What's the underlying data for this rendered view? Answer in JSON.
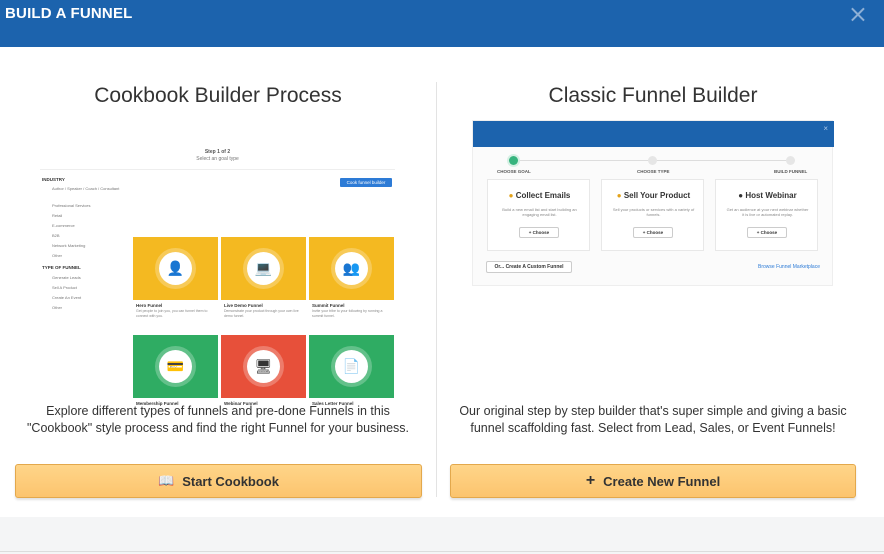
{
  "header": {
    "title": "BUILD A FUNNEL",
    "close_label": "×"
  },
  "cookbook": {
    "title": "Cookbook Builder Process",
    "description_line1": "Explore different types of funnels and pre-done Funnels in this",
    "description_line2": "\"Cookbook\" style process and find the right Funnel for your business.",
    "button_label": "Start Cookbook",
    "button_icon": "book-icon",
    "preview": {
      "step_label": "Step 1 of 2",
      "step_sub": "Select an goal type",
      "start_label": "Cook funnel builder",
      "industry_heading": "INDUSTRY",
      "industry_items": [
        "Author / Speaker / Coach / Consultant",
        "Professional Services",
        "Retail",
        "E-commerce",
        "B2B",
        "Network Marketing",
        "Other"
      ],
      "type_heading": "TYPE OF FUNNEL",
      "type_items": [
        "Generate Leads",
        "Sell A Product",
        "Create An Event",
        "Other"
      ],
      "tiles": [
        {
          "caption": "Hero Funnel",
          "sub": "Get people to join you, you can funnel them to connect with you.",
          "color": "#f4b921",
          "icon": "👤"
        },
        {
          "caption": "Live Demo Funnel",
          "sub": "Demonstrate your product through your own live demo funnel.",
          "color": "#f4b921",
          "icon": "💻"
        },
        {
          "caption": "Summit Funnel",
          "sub": "Invite your tribe to your following by running a summit funnel.",
          "color": "#f4b921",
          "icon": "👥"
        },
        {
          "caption": "Membership Funnel",
          "sub": "",
          "color": "#2fac63",
          "icon": "💳"
        },
        {
          "caption": "Webinar Funnel",
          "sub": "",
          "color": "#e7503a",
          "icon": "🖥"
        },
        {
          "caption": "Sales Letter Funnel",
          "sub": "",
          "color": "#2fac63",
          "icon": "📄"
        }
      ]
    }
  },
  "classic": {
    "title": "Classic Funnel Builder",
    "description_line1": "Our original step by step builder that's super simple and giving a basic",
    "description_line2": "funnel scaffolding fast. Select from Lead, Sales, or Event Funnels!",
    "button_label": "Create New Funnel",
    "button_icon": "plus-icon",
    "preview": {
      "close_label": "×",
      "steps": [
        "CHOOSE GOAL",
        "CHOOSE TYPE",
        "BUILD FUNNEL"
      ],
      "cards": [
        {
          "title": "Collect Emails",
          "desc": "Build a new email list and start building an engaging email list.",
          "btn": "+ Choose",
          "icon": "envelope-icon"
        },
        {
          "title": "Sell Your Product",
          "desc": "Sell your products or services with a variety of funnels.",
          "btn": "+ Choose",
          "icon": "cart-icon"
        },
        {
          "title": "Host Webinar",
          "desc": "Get an audience at your next webinar whether it is live or automated replay.",
          "btn": "+ Choose",
          "icon": "webinar-icon"
        }
      ],
      "custom_label": "Or... Create A Custom Funnel",
      "marketplace_label": "Browse Funnel Marketplace"
    }
  }
}
